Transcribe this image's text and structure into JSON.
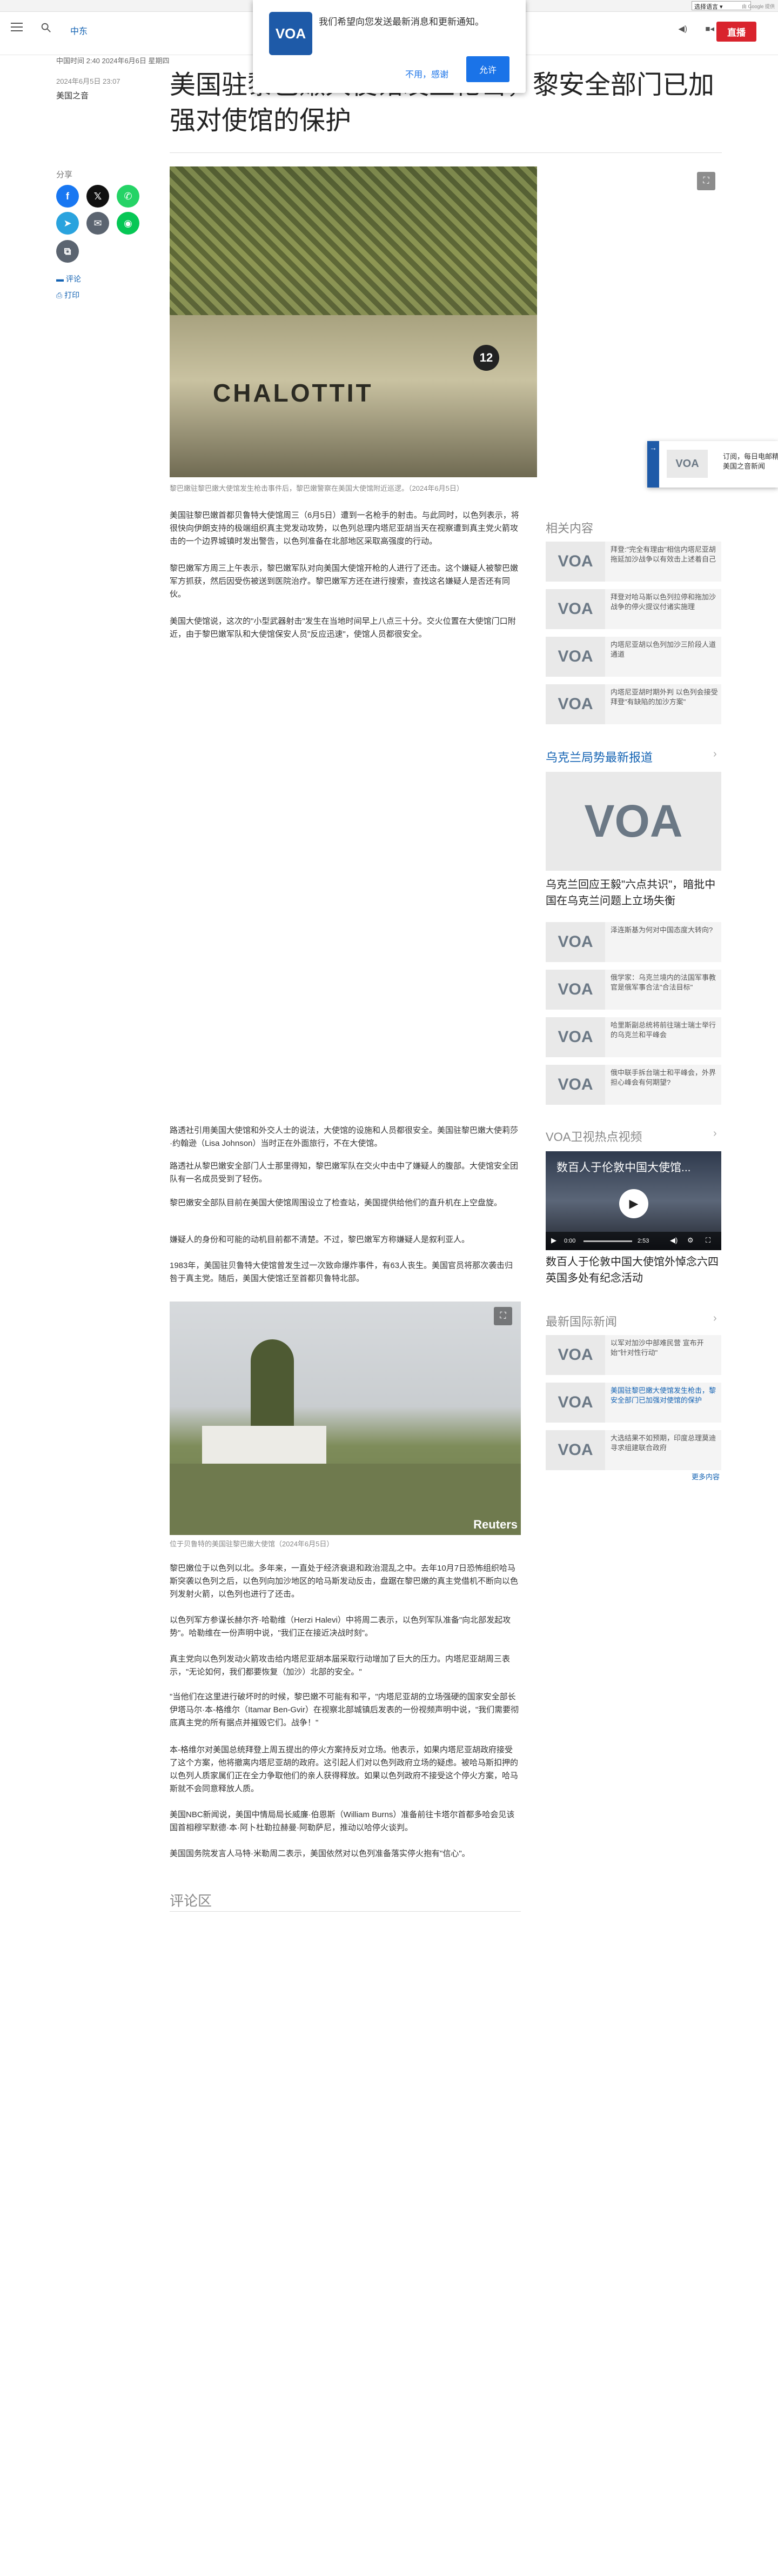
{
  "utilbar": {
    "lang_select": "选择语言",
    "powered": "由 Google 提供"
  },
  "header": {
    "nav_label": "中东",
    "live_label": "直播"
  },
  "notify": {
    "message": "我们希望向您发送最新消息和更新通知。",
    "no": "不用，感谢",
    "yes": "允许"
  },
  "meta": {
    "dateline": "中国时间 2:40 2024年6月6日 星期四",
    "published": "2024年6月5日 23:07",
    "category": "美国之音"
  },
  "article": {
    "title": "美国驻黎巴嫩大使馆发生枪击，黎安全部门已加强对使馆的保护",
    "share_label": "分享",
    "comment_action": "评论",
    "print_action": "打印",
    "hero_caption": "黎巴嫩驻黎巴嫩大使馆发生枪击事件后，黎巴嫩警察在美国大使馆附近巡逻。（2024年6月5日）",
    "hero_plate": "CHALOTTIT",
    "hero_number": "12",
    "paragraphs_a": [
      "美国驻黎巴嫩首都贝鲁特大使馆周三（6月5日）遭到一名枪手的射击。与此同时，以色列表示，将很快向伊朗支持的极端组织真主党发动攻势，以色列总理内塔尼亚胡当天在视察遭到真主党火箭攻击的一个边界城镇时发出警告，以色列准备在北部地区采取高强度的行动。",
      "黎巴嫩军方周三上午表示，黎巴嫩军队对向美国大使馆开枪的人进行了还击。这个嫌疑人被黎巴嫩军方抓获，然后因受伤被送到医院治疗。黎巴嫩军方还在进行搜索，查找这名嫌疑人是否还有同伙。",
      "美国大使馆说，这次的\"小型武器射击\"发生在当地时间早上八点三十分。交火位置在大使馆门口附近，由于黎巴嫩军队和大使馆保安人员\"反应迅速\"，使馆人员都很安全。"
    ],
    "paragraphs_b": [
      "路透社引用美国大使馆和外交人士的说法，大使馆的设施和人员都很安全。美国驻黎巴嫩大使莉莎·约翰逊（Lisa Johnson）当时正在外面旅行，不在大使馆。",
      "路透社从黎巴嫩安全部门人士那里得知，黎巴嫩军队在交火中击中了嫌疑人的腹部。大使馆安全团队有一名成员受到了轻伤。",
      "黎巴嫩安全部队目前在美国大使馆周围设立了检查站，美国提供给他们的直升机在上空盘旋。",
      "嫌疑人的身份和可能的动机目前都不清楚。不过，黎巴嫩军方称嫌疑人是叙利亚人。",
      "1983年，美国驻贝鲁特大使馆曾发生过一次致命爆炸事件，有63人丧生。美国官员将那次袭击归咎于真主党。随后，美国大使馆迁至首都贝鲁特北部。"
    ],
    "img2_caption": "位于贝鲁特的美国驻黎巴嫩大使馆（2024年6月5日）",
    "img2_watermark": "Reuters",
    "paragraphs_c": [
      "黎巴嫩位于以色列以北。多年来，一直处于经济衰退和政治混乱之中。去年10月7日恐怖组织哈马斯突袭以色列之后，以色列向加沙地区的哈马斯发动反击，盘踞在黎巴嫩的真主党借机不断向以色列发射火箭，以色列也进行了还击。",
      "以色列军方参谋长赫尔齐·哈勒维（Herzi Halevi）中将周二表示，以色列军队准备\"向北部发起攻势\"。哈勒维在一份声明中说，\"我们正在接近决战时刻\"。",
      "真主党向以色列发动火箭攻击给内塔尼亚胡本届采取行动增加了巨大的压力。内塔尼亚胡周三表示，\"无论如何，我们都要恢复（加沙）北部的安全。\"",
      "\"当他们在这里进行破坏时的时候，黎巴嫩不可能有和平，\"内塔尼亚胡的立场强硬的国家安全部长伊塔马尔·本-格维尔（Itamar Ben-Gvir）在视察北部城镇后发表的一份视频声明中说，\"我们需要彻底真主党的所有据点并摧毁它们。战争！\"",
      "本-格维尔对美国总统拜登上周五提出的停火方案持反对立场。他表示，如果内塔尼亚胡政府接受了这个方案，他将撤离内塔尼亚胡的政府。这引起人们对以色列政府立场的疑虑。被哈马斯扣押的以色列人质家属们正在全力争取他们的亲人获得释放。如果以色列政府不接受这个停火方案，哈马斯就不会同意释放人质。",
      "美国NBC新闻说，美国中情局局长威廉·伯恩斯（William Burns）准备前往卡塔尔首都多哈会见该国首相穆罕默德·本·阿卜杜勒拉赫曼·阿勒萨尼，推动以哈停火谈判。",
      "美国国务院发言人马特·米勒周二表示，美国依然对以色列准备落实停火抱有\"信心\"。"
    ],
    "comments_heading": "评论区"
  },
  "sidebar": {
    "related_heading": "相关内容",
    "related": [
      "拜登:\"完全有理由\"相信内塔尼亚胡拖延加沙战争以有效击上述着自己",
      "拜登对哈马斯以色列拉停和拖加沙战争的停火提议付诸实施理",
      "内塔尼亚胡以色列加沙三阶段人道通道",
      "内塔尼亚胡时期外判 以色列会接受拜登\"有缺陷的加沙方案\""
    ],
    "ukraine_heading": "乌克兰局势最新报道",
    "ukraine_big_title": "乌克兰回应王毅\"六点共识\"，暗批中国在乌克兰问题上立场失衡",
    "ukraine_items": [
      "泽连斯基为何对中国态度大转向?",
      "俄学家：乌克兰境内的法国军事教官是俄军事合法\"合法目标\"",
      "哈里斯副总统将前往瑞士瑞士举行的乌克兰和平峰会",
      "俄中联手拆台瑞士和平峰会，外界担心峰会有何期望?"
    ],
    "video_heading": "VOA卫视热点视频",
    "video_overlay_title": "数百人于伦敦中国大使馆...",
    "video_time_current": "0:00",
    "video_time_duration": "2:53",
    "video_caption": "数百人于伦敦中国大使馆外悼念六四 英国多处有纪念活动",
    "intl_heading": "最新国际新闻",
    "intl_items": [
      "以军对加沙中部难民营 宣布开始\"针对性行动\"",
      "美国驻黎巴嫩大使馆发生枪击，黎安全部门已加强对使馆的保护",
      "大选结果不如预期，印度总理莫迪寻求组建联合政府"
    ],
    "more_label": "更多内容"
  },
  "float": {
    "text": "订阅，每日电邮精选美国之音新闻"
  },
  "logo_text": "VOA",
  "colors": {
    "accent": "#1463b3",
    "live": "#d9232d",
    "brand": "#1e5aa8"
  }
}
